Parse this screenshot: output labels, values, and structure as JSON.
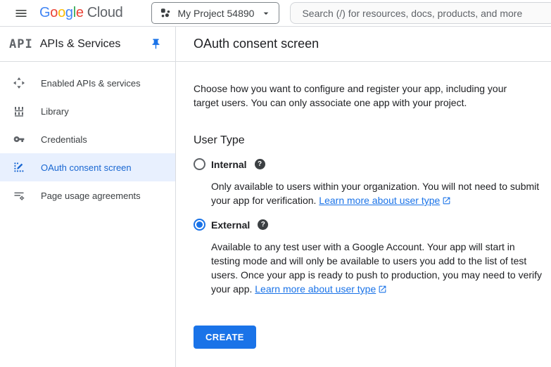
{
  "header": {
    "logo": {
      "letters": [
        {
          "ch": "G",
          "color": "#4285f4"
        },
        {
          "ch": "o",
          "color": "#ea4335"
        },
        {
          "ch": "o",
          "color": "#fbbc05"
        },
        {
          "ch": "g",
          "color": "#4285f4"
        },
        {
          "ch": "l",
          "color": "#34a853"
        },
        {
          "ch": "e",
          "color": "#ea4335"
        }
      ],
      "suffix": "Cloud"
    },
    "project_selector": {
      "label": "My Project 54890",
      "icon": "project-grid-icon",
      "caret_icon": "chevron-down-icon"
    },
    "search": {
      "placeholder": "Search (/) for resources, docs, products, and more"
    },
    "menu_icon": "hamburger-menu-icon"
  },
  "sidebar": {
    "logo_text": "API",
    "title": "APIs & Services",
    "pin_icon": "push-pin-icon",
    "items": [
      {
        "label": "Enabled APIs & services",
        "icon": "apis-services-icon",
        "selected": false
      },
      {
        "label": "Library",
        "icon": "library-icon",
        "selected": false
      },
      {
        "label": "Credentials",
        "icon": "key-icon",
        "selected": false
      },
      {
        "label": "OAuth consent screen",
        "icon": "oauth-consent-icon",
        "selected": true
      },
      {
        "label": "Page usage agreements",
        "icon": "page-usage-icon",
        "selected": false
      }
    ]
  },
  "main": {
    "title": "OAuth consent screen",
    "intro": "Choose how you want to configure and register your app, including your target users. You can only associate one app with your project.",
    "user_type": {
      "heading": "User Type",
      "help_glyph": "?",
      "options": [
        {
          "label": "Internal",
          "selected": false,
          "description": "Only available to users within your organization. You will not need to submit your app for verification. ",
          "link_label": "Learn more about user type"
        },
        {
          "label": "External",
          "selected": true,
          "description": "Available to any test user with a Google Account. Your app will start in testing mode and will only be available to users you add to the list of test users. Once your app is ready to push to production, you may need to verify your app. ",
          "link_label": "Learn more about user type"
        }
      ]
    },
    "create_button_label": "CREATE"
  },
  "colors": {
    "accent_blue": "#1a73e8",
    "selected_nav_text": "#1967d2",
    "selected_nav_bg": "#e8f0fe",
    "text_primary": "#202124",
    "text_secondary": "#5f6368",
    "border": "#dadce0"
  }
}
